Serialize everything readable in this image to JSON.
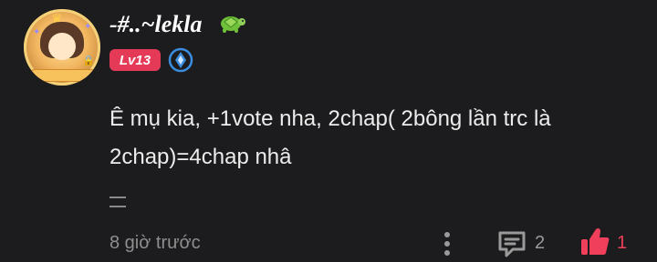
{
  "user": {
    "name": "-#..~lekla",
    "level_badge": "Lv13",
    "name_emoji_icon": "turtle-icon",
    "verified_icon": "blue-shield-diamond-icon"
  },
  "comment": {
    "text": "Ê mụ kia, +1vote nha, 2chap( 2bông lần trc là 2chap)=4chap nhâ"
  },
  "footer": {
    "timestamp": "8 giờ trước",
    "reply_count": "2",
    "like_count": "1"
  },
  "colors": {
    "background": "#1c1c1e",
    "level_badge": "#e53a57",
    "like": "#ef3f5a",
    "verify": "#3a8dde"
  }
}
